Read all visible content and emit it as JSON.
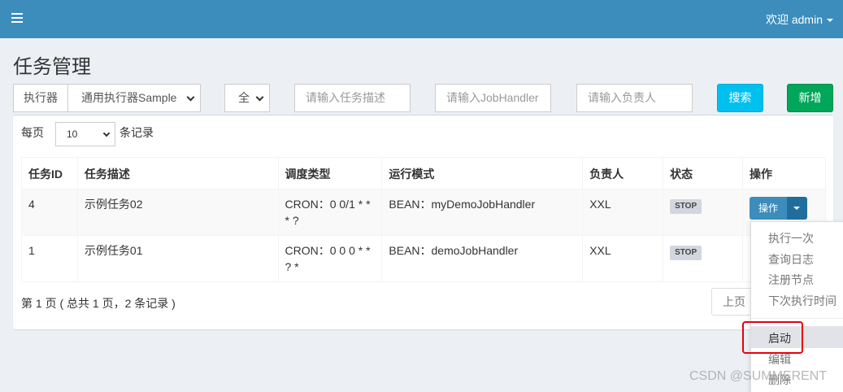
{
  "header": {
    "user_label": "欢迎 admin"
  },
  "page": {
    "title": "任务管理"
  },
  "filters": {
    "executor_label": "执行器",
    "executor_value": "通用执行器Sample",
    "status_value": "全",
    "desc_placeholder": "请输入任务描述",
    "handler_placeholder": "请输入JobHandler",
    "author_placeholder": "请输入负责人",
    "search_label": "搜索",
    "add_label": "新增"
  },
  "table_length": {
    "before": "每页",
    "value": "10",
    "after": "条记录"
  },
  "table": {
    "columns": [
      "任务ID",
      "任务描述",
      "调度类型",
      "运行模式",
      "负责人",
      "状态",
      "操作"
    ],
    "rows": [
      {
        "id": "4",
        "desc": "示例任务02",
        "schedule": "CRON：0 0/1 * * * ?",
        "mode": "BEAN：myDemoJobHandler",
        "author": "XXL",
        "status": "STOP",
        "op_label": "操作"
      },
      {
        "id": "1",
        "desc": "示例任务01",
        "schedule": "CRON：0 0 0 * * ? *",
        "mode": "BEAN：demoJobHandler",
        "author": "XXL",
        "status": "STOP"
      }
    ]
  },
  "footer": {
    "info": "第 1 页 ( 总共 1 页，2 条记录 )",
    "prev_label": "上页"
  },
  "dropdown": {
    "items": [
      "执行一次",
      "查询日志",
      "注册节点",
      "下次执行时间",
      "启动",
      "编辑",
      "删除"
    ]
  },
  "watermark": "CSDN @SUMMERENT"
}
